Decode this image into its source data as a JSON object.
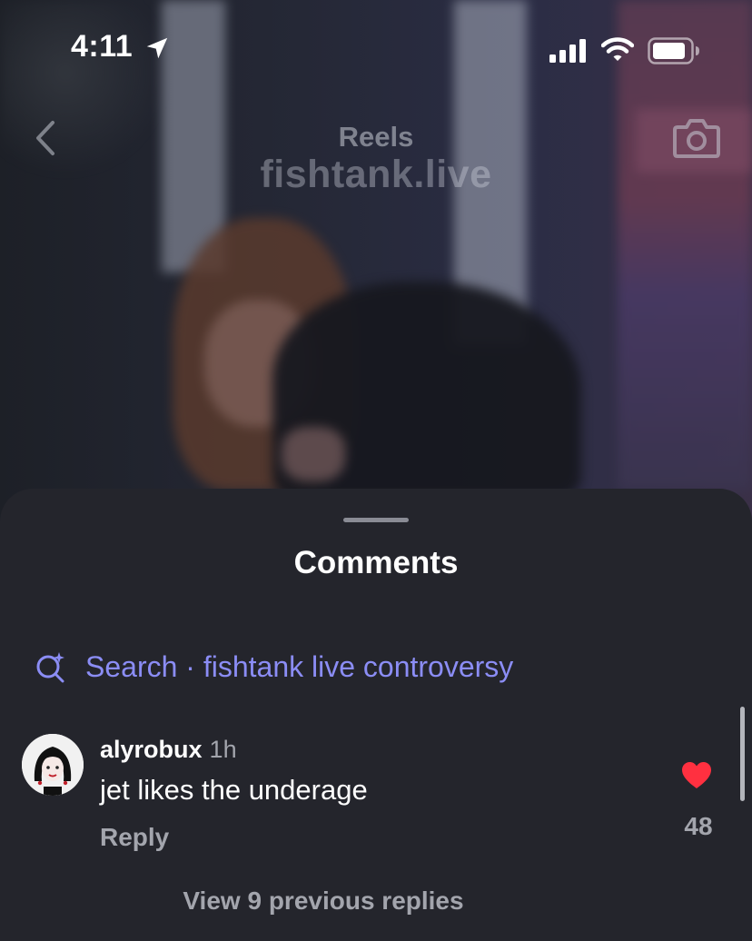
{
  "status_bar": {
    "time": "4:11",
    "icons": [
      "location-arrow-icon",
      "cellular-signal-icon",
      "wifi-icon",
      "battery-icon"
    ]
  },
  "header": {
    "title": "Reels",
    "watermark": "fishtank.live",
    "icons": [
      "back-chevron-icon",
      "camera-icon"
    ]
  },
  "comments_sheet": {
    "title": "Comments",
    "search": {
      "icon": "search-sparkle-icon",
      "label": "Search · fishtank live controversy"
    },
    "comments": [
      {
        "username": "alyrobux",
        "time": "1h",
        "text": "jet likes the underage",
        "reply_label": "Reply",
        "likes": "48"
      }
    ],
    "view_replies": "View 9 previous replies"
  },
  "colors": {
    "sheet_bg": "#24252c",
    "accent_link": "#8b8df5",
    "like_red": "#ff3040",
    "muted_text": "#a3a5ad"
  }
}
